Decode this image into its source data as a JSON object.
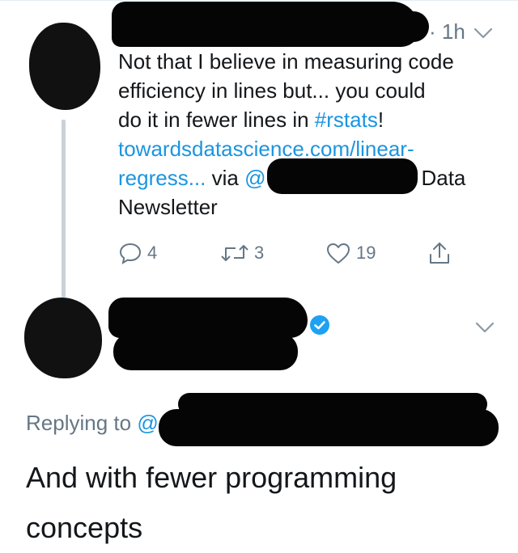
{
  "tweet1": {
    "time": "1h",
    "lines": {
      "l1": "Not that I believe in measuring code",
      "l2": "efficiency in lines but... you could",
      "l3_pre": "do it in fewer lines in ",
      "l3_tag": "#rstats",
      "l3_post": "!",
      "l4": "towardsdatascience.com/linear-",
      "l5_link": "regress...",
      "l5_via": " via ",
      "l5_at": "@",
      "l5_tail": "Data",
      "l6": "Newsletter"
    },
    "actions": {
      "replies": "4",
      "retweets": "3",
      "likes": "19"
    }
  },
  "tweet2": {
    "replying_prefix": "Replying to ",
    "replying_at": "@",
    "text_line1": "And with fewer programming",
    "text_line2": "concepts"
  },
  "icons": {
    "reply": "reply-icon",
    "retweet": "retweet-icon",
    "like": "heart-icon",
    "share": "share-icon",
    "chevron": "chevron-down-icon",
    "verified": "verified-badge-icon"
  },
  "colors": {
    "link": "#1b95e0",
    "muted": "#657786",
    "text": "#14171a",
    "thread_line": "#c9d1d8"
  }
}
